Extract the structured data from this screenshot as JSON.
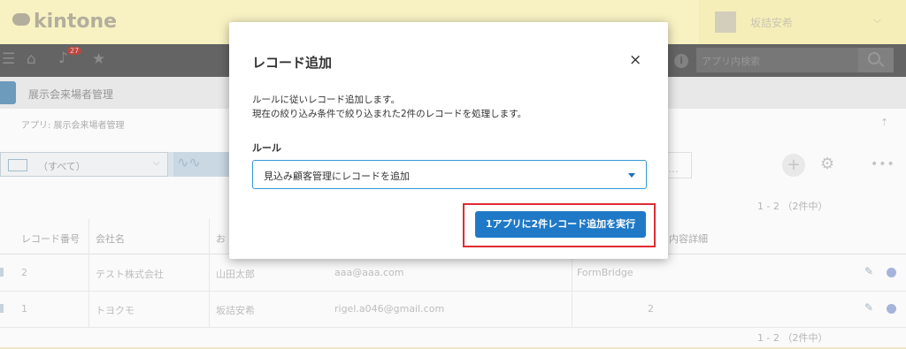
{
  "header": {
    "logo_text": "kintone",
    "user_name": "坂詰安希",
    "notification_count": "27",
    "app_search_placeholder": "アプリ内検索"
  },
  "app": {
    "title": "展示会来場者管理",
    "breadcrumb": "アプリ: 展示会来場者管理"
  },
  "view": {
    "selected_view": "（すべて）"
  },
  "records": {
    "count_label": "1 - 2 （2件中）",
    "columns": [
      "レコード番号",
      "会社名",
      "お",
      "",
      "内容詳細"
    ],
    "rows": [
      {
        "id": "2",
        "company": "テスト株式会社",
        "person": "山田太郎",
        "email": "aaa@aaa.com",
        "extra": "FormBridge"
      },
      {
        "id": "1",
        "company": "トヨクモ",
        "person": "坂詰安希",
        "email": "rigel.a046@gmail.com",
        "extra": "2"
      }
    ]
  },
  "dialog": {
    "title": "レコード追加",
    "close_label": "×",
    "description_line1": "ルールに従いレコード追加します。",
    "description_line2": "現在の絞り込み条件で絞り込まれた2件のレコードを処理します。",
    "rule_label": "ルール",
    "rule_selected": "見込み顧客管理にレコードを追加",
    "run_button_label": "1アプリに2件レコード追加を実行"
  },
  "colors": {
    "primary_button": "#1f79c6",
    "highlight_border": "#e02b32",
    "select_border": "#3498db"
  }
}
